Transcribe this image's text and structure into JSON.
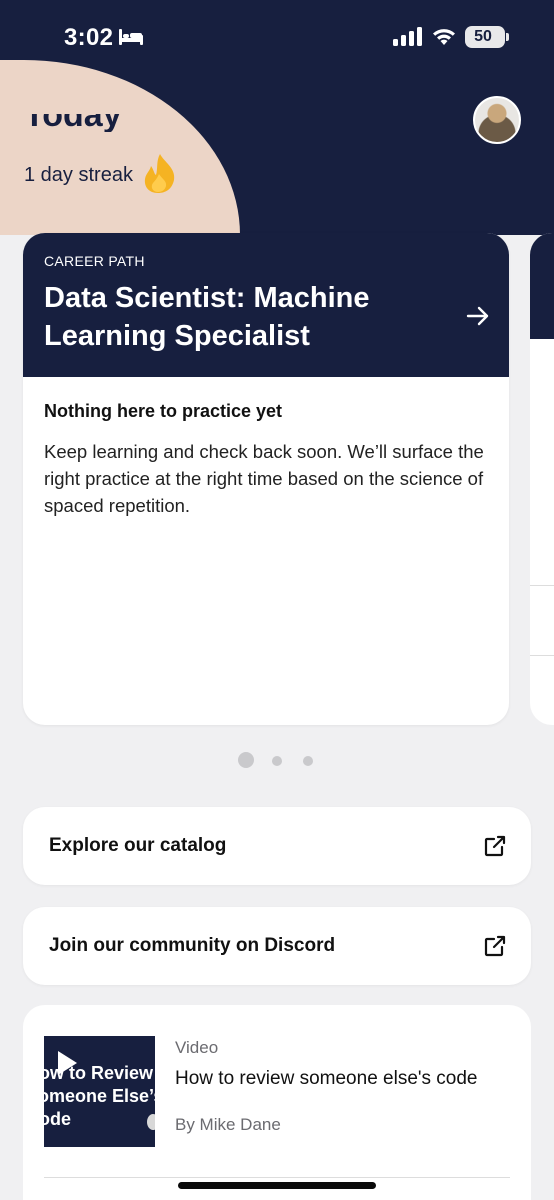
{
  "status_bar": {
    "time": "3:02",
    "battery": "50",
    "battery_level": 0.5
  },
  "header": {
    "title": "Today",
    "streak": "1 day streak"
  },
  "career_card": {
    "kicker": "CAREER PATH",
    "title": "Data Scientist: Machine Learning Specialist",
    "empty_title": "Nothing here to practice yet",
    "empty_text": "Keep learning and check back soon. We’ll surface the right practice at the right time based on the science of spaced repetition."
  },
  "pager": {
    "count": 3,
    "active": 0
  },
  "links": [
    {
      "label": "Explore our catalog"
    },
    {
      "label": "Join our community on Discord"
    }
  ],
  "video": {
    "type": "Video",
    "title": "How to review someone else's code",
    "author": "By Mike Dane",
    "thumb_text": "How to Review Someone Else’s Code"
  },
  "colors": {
    "navy": "#171f3f",
    "peach": "#ecd5c7",
    "flame": "#f5b323"
  }
}
